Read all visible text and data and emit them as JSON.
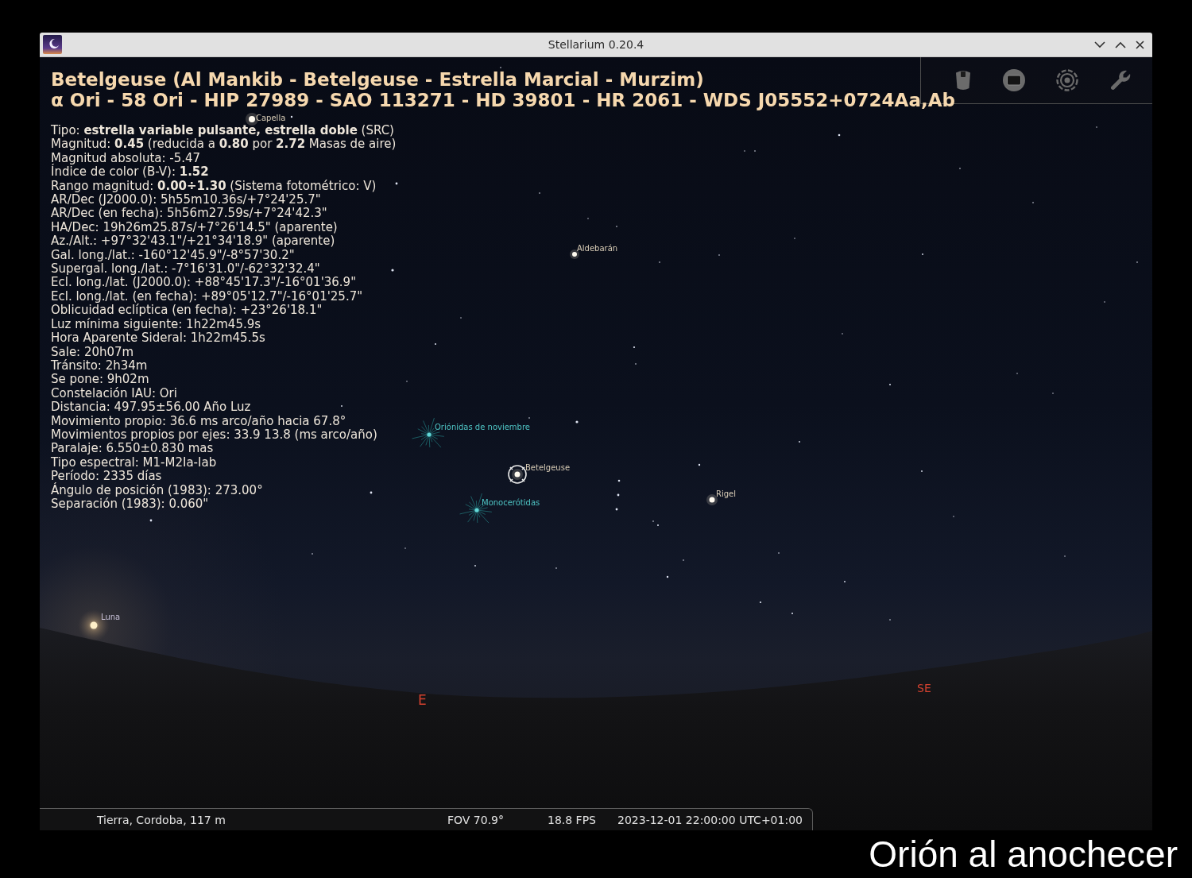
{
  "window": {
    "title": "Stellarium 0.20.4"
  },
  "object_info": {
    "title": "Betelgeuse (Al Mankib - Betelgeuse - Estrella Marcial - Murzim)",
    "designations": "α Ori - 58 Ori - HIP 27989 - SAO 113271 - HD 39801 - HR 2061 - WDS J05552+0724Aa,Ab",
    "lines": [
      "Tipo: **estrella variable pulsante, estrella doble** (SRC)",
      "Magnitud: **0.45** (reducida a **0.80** por **2.72** Masas de aire)",
      "Magnitud absoluta: -5.47",
      "Índice de color (B-V): **1.52**",
      "Rango magnitud: **0.00÷1.30** (Sistema fotométrico: V)",
      "AR/Dec (J2000.0): 5h55m10.36s/+7°24'25.7\"",
      "AR/Dec (en fecha): 5h56m27.59s/+7°24'42.3\"",
      "HA/Dec: 19h26m25.87s/+7°26'14.5\" (aparente)",
      "Az./Alt.: +97°32'43.1\"/+21°34'18.9\" (aparente)",
      "Gal. long./lat.: -160°12'45.9\"/-8°57'30.2\"",
      "Supergal. long./lat.: -7°16'31.0\"/-62°32'32.4\"",
      "Ecl. long./lat. (J2000.0): +88°45'17.3\"/-16°01'36.9\"",
      "Ecl. long./lat. (en fecha): +89°05'12.7\"/-16°01'25.7\"",
      "Oblicuidad eclíptica (en fecha): +23°26'18.1\"",
      "Luz mínima siguiente: 1h22m45.9s",
      "Hora Aparente Sideral: 1h22m45.5s",
      "Sale: 20h07m",
      "Tránsito: 2h34m",
      "Se pone: 9h02m",
      "Constelación IAU: Ori",
      "Distancia: 497.95±56.00 Año Luz",
      "Movimiento propio: 36.6 ms arco/año hacia 67.8°",
      "Movimientos propios por ejes: 33.9 13.8 (ms arco/año)",
      "Paralaje: 6.550±0.830 mas",
      "Tipo espectral: M1-M2Ia-Iab",
      "Período: 2335 días",
      "Ángulo de posición (1983): 273.00°",
      "Separación (1983): 0.060\""
    ]
  },
  "sky_objects": [
    {
      "kind": "star",
      "label": "Capella",
      "selected": false
    },
    {
      "kind": "star",
      "label": "Aldebarán",
      "selected": false
    },
    {
      "kind": "meteor_shower",
      "label": "Oriónidas de noviembre",
      "selected": false
    },
    {
      "kind": "star",
      "label": "Betelgeuse",
      "selected": true
    },
    {
      "kind": "star",
      "label": "Rigel",
      "selected": false
    },
    {
      "kind": "meteor_shower",
      "label": "Monocerótidas",
      "selected": false
    },
    {
      "kind": "moon",
      "label": "Luna",
      "selected": false
    }
  ],
  "cardinal_points": [
    {
      "label": "E"
    },
    {
      "label": "SE"
    }
  ],
  "status_bar": {
    "location": "Tierra, Cordoba, 117 m",
    "fov": "FOV 70.9°",
    "fps": "18.8 FPS",
    "datetime": "2023-12-01 22:00:00 UTC+01:00"
  },
  "caption": "Orión al anochecer"
}
